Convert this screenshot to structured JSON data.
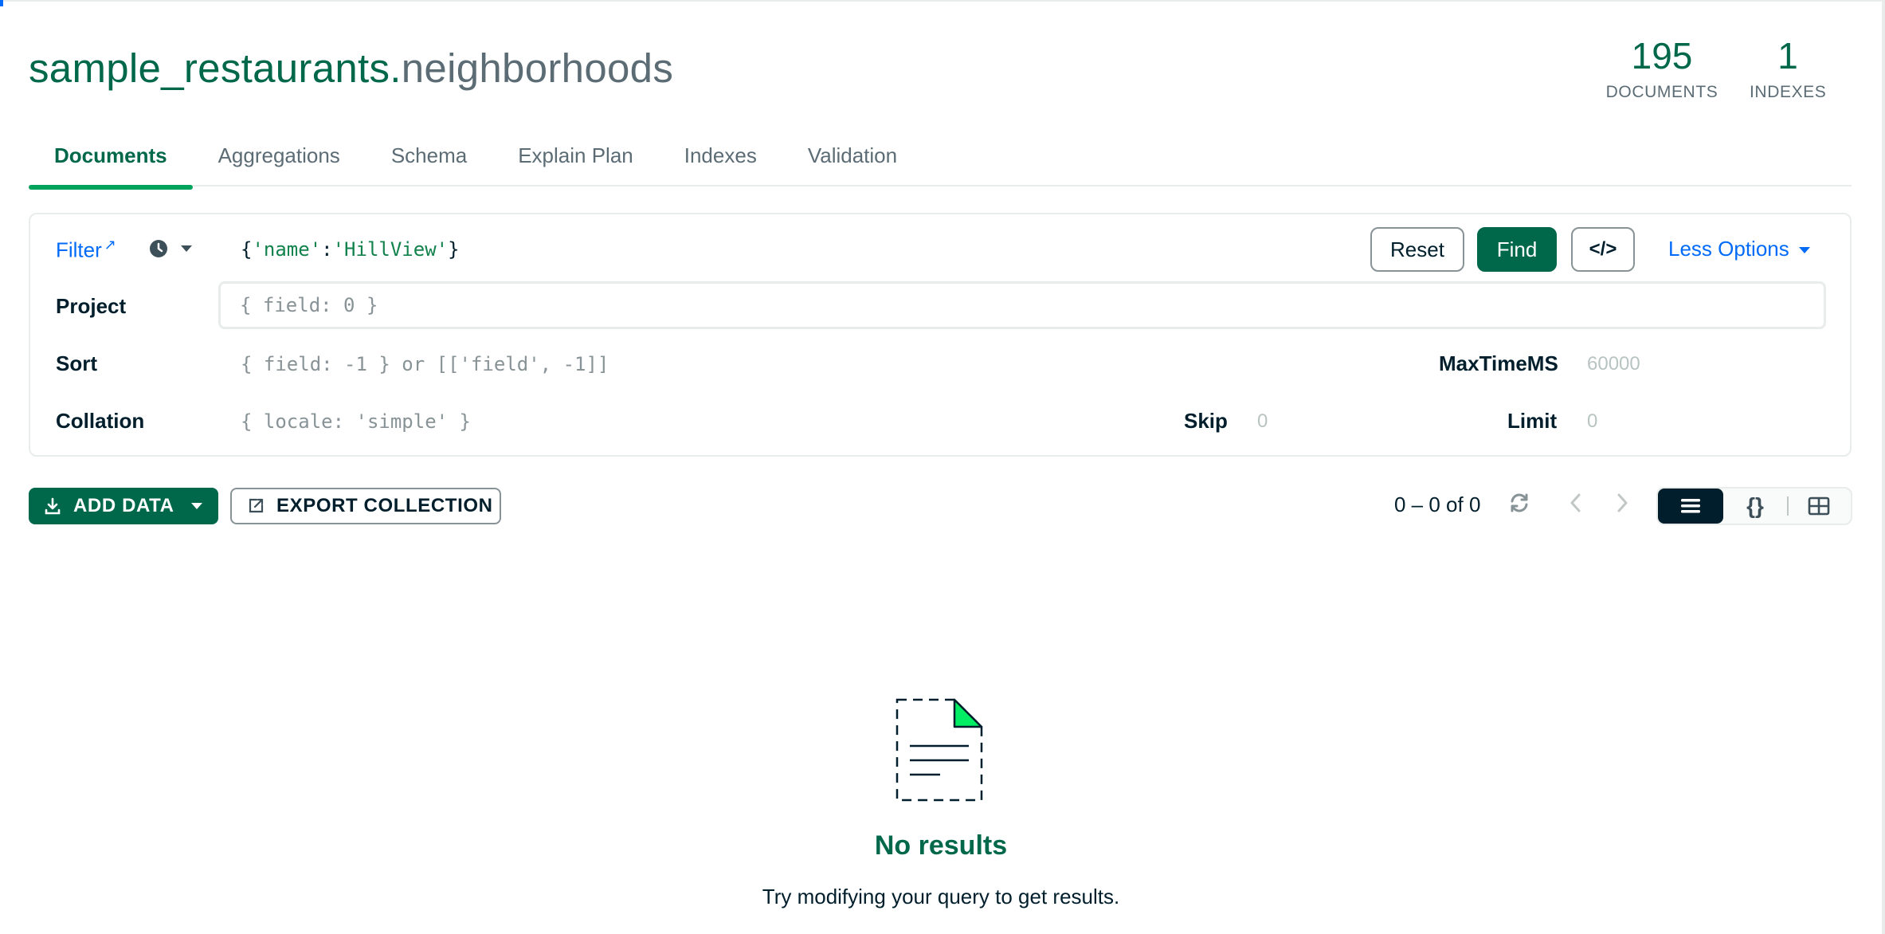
{
  "header": {
    "db_name": "sample_restaurants.",
    "collection_name": "neighborhoods",
    "stats": [
      {
        "value": "195",
        "label": "DOCUMENTS"
      },
      {
        "value": "1",
        "label": "INDEXES"
      }
    ]
  },
  "tabs": [
    {
      "label": "Documents",
      "active": true
    },
    {
      "label": "Aggregations"
    },
    {
      "label": "Schema"
    },
    {
      "label": "Explain Plan"
    },
    {
      "label": "Indexes"
    },
    {
      "label": "Validation"
    }
  ],
  "query": {
    "filter_label": "Filter",
    "filter_value": {
      "open": "{",
      "key": "'name'",
      "colon": ":",
      "val": "'HillView'",
      "close": "}"
    },
    "reset_label": "Reset",
    "find_label": "Find",
    "code_label": "</>",
    "less_options_label": "Less Options",
    "project_label": "Project",
    "project_placeholder": "{ field: 0 }",
    "sort_label": "Sort",
    "sort_placeholder": "{ field: -1 } or [['field', -1]]",
    "maxtime_label": "MaxTimeMS",
    "maxtime_placeholder": "60000",
    "collation_label": "Collation",
    "collation_placeholder": "{ locale: 'simple' }",
    "skip_label": "Skip",
    "skip_placeholder": "0",
    "limit_label": "Limit",
    "limit_placeholder": "0"
  },
  "toolbar": {
    "add_data_label": "ADD DATA",
    "export_label": "EXPORT COLLECTION",
    "pagination_text": "0 – 0 of 0"
  },
  "empty_state": {
    "title": "No results",
    "subtitle": "Try modifying your query to get results."
  },
  "colors": {
    "brand_green": "#00684A",
    "link_blue": "#016BF8",
    "text_dark": "#001E2B",
    "text_muted": "#5C6C75"
  }
}
